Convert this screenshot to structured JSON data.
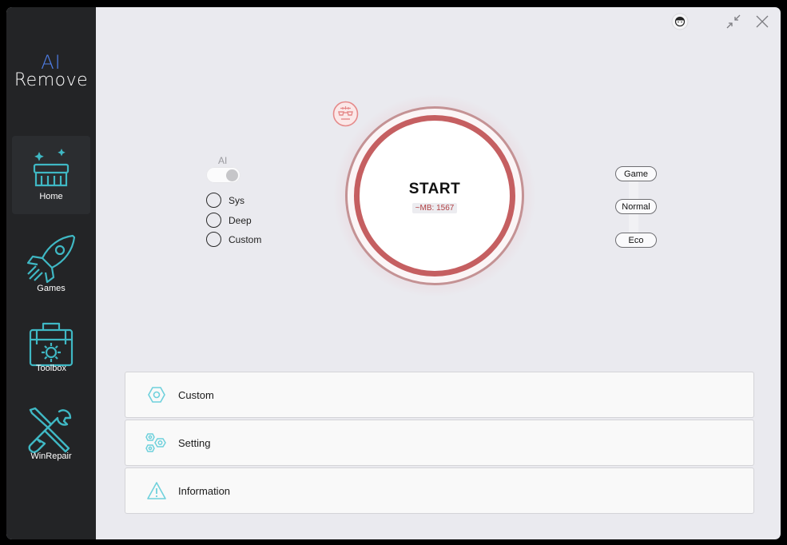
{
  "app": {
    "logo_ai": "AI",
    "logo_remove": "Remove"
  },
  "sidebar": {
    "items": [
      {
        "label": "Home",
        "icon": "broom-icon",
        "active": true
      },
      {
        "label": "Games",
        "icon": "rocket-icon",
        "active": false
      },
      {
        "label": "Toolbox",
        "icon": "toolbox-icon",
        "active": false
      },
      {
        "label": "WinRepair",
        "icon": "tools-icon",
        "active": false
      }
    ]
  },
  "window_controls": {
    "avatar": "avatar-icon",
    "collapse": "collapse-icon",
    "close": "close-icon"
  },
  "ai_toggle": {
    "label": "AI",
    "state": "off"
  },
  "scan_modes": [
    {
      "label": "Sys"
    },
    {
      "label": "Deep"
    },
    {
      "label": "Custom"
    }
  ],
  "start": {
    "label": "START",
    "memory": "~MB: 1567"
  },
  "power_modes": [
    {
      "label": "Game"
    },
    {
      "label": "Normal"
    },
    {
      "label": "Eco"
    }
  ],
  "panels": [
    {
      "label": "Custom",
      "icon": "hexagon-icon"
    },
    {
      "label": "Setting",
      "icon": "gears-icon"
    },
    {
      "label": "Information",
      "icon": "warning-icon"
    }
  ],
  "colors": {
    "sidebar_bg": "#232426",
    "content_bg": "#eaeaef",
    "accent_teal": "#3fb8c4",
    "start_ring": "#c55f61",
    "logo_blue": "#4f7fe8"
  }
}
